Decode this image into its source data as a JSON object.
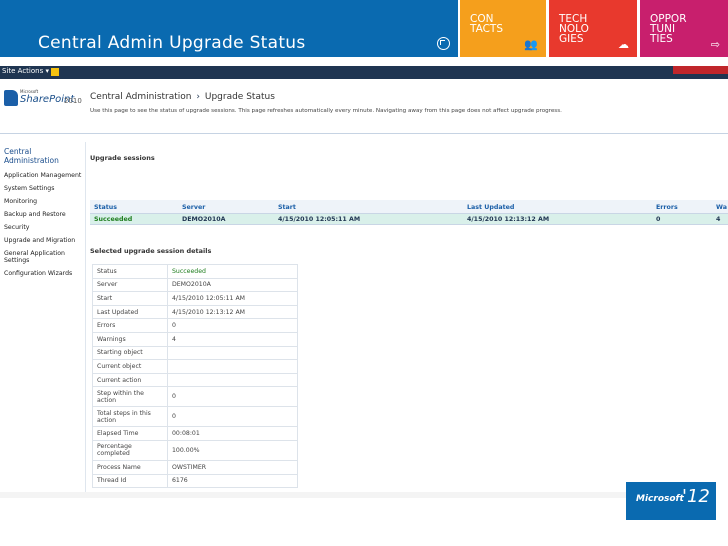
{
  "slide": {
    "title": "Central Admin Upgrade Status",
    "tiles": [
      {
        "lines": [
          "CON",
          "TACTS"
        ],
        "icon": "👥"
      },
      {
        "lines": [
          "TECH",
          "NOLO",
          "GIES"
        ],
        "icon": "☁"
      },
      {
        "lines": [
          "OPPOR",
          "TUNI",
          "TIES"
        ],
        "icon": "⇨"
      }
    ],
    "badge": {
      "brand": "Microsoft",
      "version": "'12"
    }
  },
  "colors": {
    "title_bar": "#0a6ab0",
    "tile_contacts": "#f59f1c",
    "tile_tech": "#e8392d",
    "tile_opp": "#c81f6d",
    "site_bar": "#1f3551",
    "status_ok": "#1e7d1e"
  },
  "sharepoint": {
    "site_actions": "Site Actions ▾",
    "logo_small": "Microsoft",
    "logo_name": "SharePoint",
    "logo_version": "2010",
    "breadcrumb": {
      "root": "Central Administration",
      "sep": "›",
      "current": "Upgrade Status"
    },
    "description": "Use this page to see the status of upgrade sessions. This page refreshes automatically every minute. Navigating away from this page does not affect upgrade progress."
  },
  "nav": {
    "home": "Central Administration",
    "items": [
      "Application Management",
      "System Settings",
      "Monitoring",
      "Backup and Restore",
      "Security",
      "Upgrade and Migration",
      "General Application Settings",
      "Configuration Wizards"
    ]
  },
  "sessions": {
    "title": "Upgrade sessions",
    "headers": [
      "Status",
      "Server",
      "Start",
      "Last Updated",
      "Errors",
      "Wa"
    ],
    "row": [
      "Succeeded",
      "DEMO2010A",
      "4/15/2010 12:05:11 AM",
      "4/15/2010 12:13:12 AM",
      "0",
      "4"
    ]
  },
  "details": {
    "title": "Selected upgrade session details",
    "rows": [
      {
        "label": "Status",
        "value": "Succeeded"
      },
      {
        "label": "Server",
        "value": "DEMO2010A"
      },
      {
        "label": "Start",
        "value": "4/15/2010 12:05:11 AM"
      },
      {
        "label": "Last Updated",
        "value": "4/15/2010 12:13:12 AM"
      },
      {
        "label": "Errors",
        "value": "0"
      },
      {
        "label": "Warnings",
        "value": "4"
      },
      {
        "label": "Starting object",
        "value": ""
      },
      {
        "label": "Current object",
        "value": ""
      },
      {
        "label": "Current action",
        "value": ""
      },
      {
        "label": "Step within the action",
        "value": "0"
      },
      {
        "label": "Total steps in this action",
        "value": "0"
      },
      {
        "label": "Elapsed Time",
        "value": "00:08:01"
      },
      {
        "label": "Percentage completed",
        "value": "100.00%"
      },
      {
        "label": "Process Name",
        "value": "OWSTIMER"
      },
      {
        "label": "Thread Id",
        "value": "6176"
      }
    ]
  }
}
